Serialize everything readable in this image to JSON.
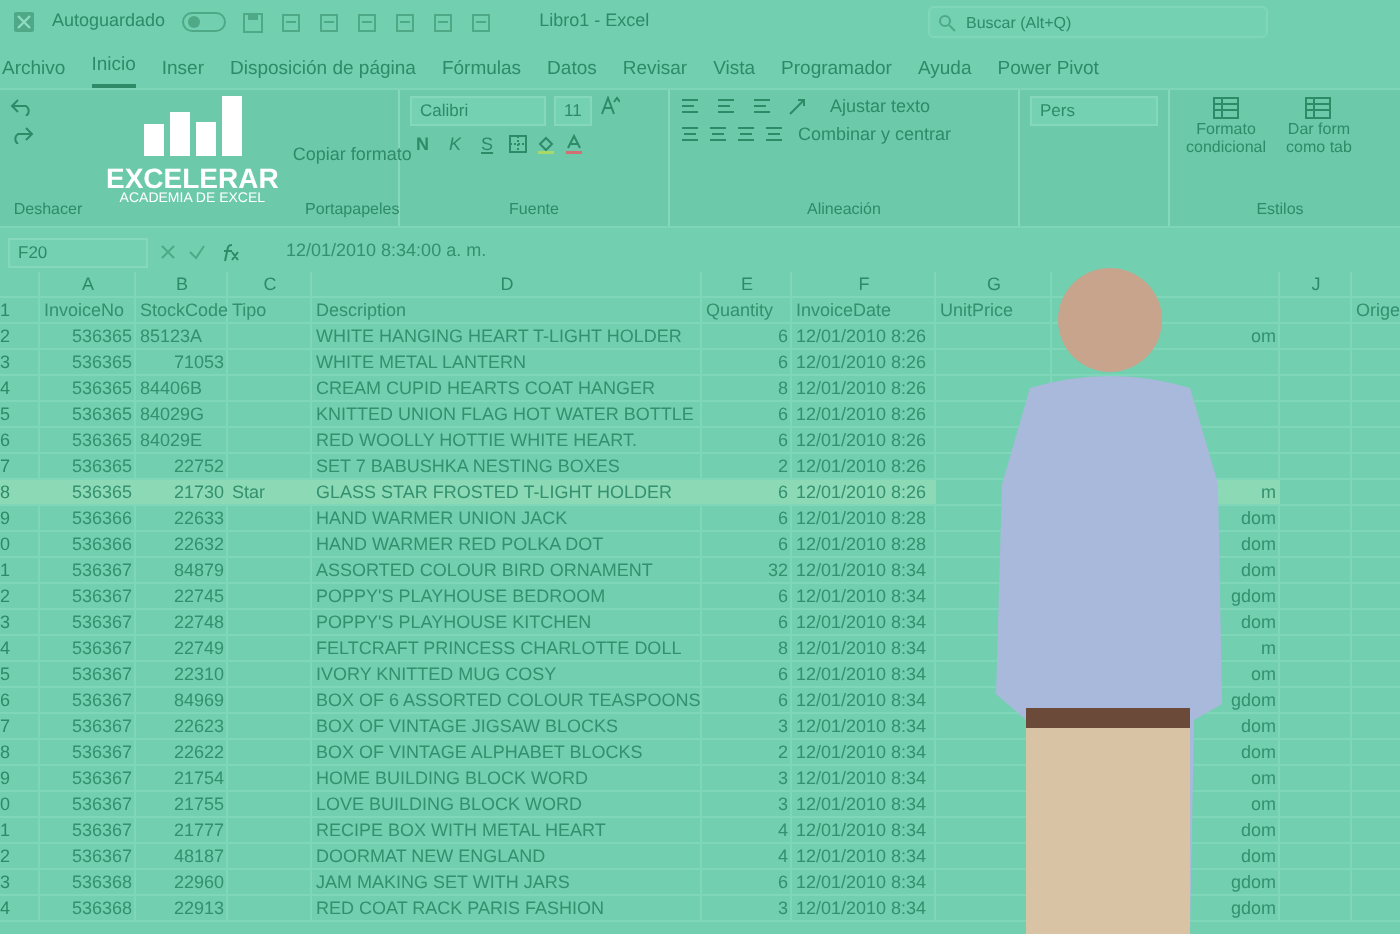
{
  "title_bar": {
    "autosave_label": "Autoguardado",
    "autosave_on": false,
    "document_title": "Libro1 - Excel",
    "search_placeholder": "Buscar (Alt+Q)"
  },
  "logo": {
    "name": "EXCELERAR",
    "tagline": "ACADEMIA DE EXCEL"
  },
  "menu_tabs": [
    {
      "label": "Archivo",
      "selected": false
    },
    {
      "label": "Inicio",
      "selected": true
    },
    {
      "label": "Inser",
      "selected": false
    },
    {
      "label": "Disposición de página",
      "selected": false
    },
    {
      "label": "Fórmulas",
      "selected": false
    },
    {
      "label": "Datos",
      "selected": false
    },
    {
      "label": "Revisar",
      "selected": false
    },
    {
      "label": "Vista",
      "selected": false
    },
    {
      "label": "Programador",
      "selected": false
    },
    {
      "label": "Ayuda",
      "selected": false
    },
    {
      "label": "Power Pivot",
      "selected": false
    }
  ],
  "ribbon": {
    "undo": {
      "label": "Deshacer"
    },
    "clipboard": {
      "label": "Portapapeles",
      "copy_format": "Copiar formato"
    },
    "font": {
      "label": "Fuente",
      "font_name": "Calibri",
      "font_size": "11",
      "bold": "N",
      "italic": "K",
      "underline": "S"
    },
    "alignment": {
      "label": "Alineación",
      "wrap_text": "Ajustar texto",
      "merge_center": "Combinar y centrar"
    },
    "number": {
      "format": "Pers"
    },
    "styles": {
      "label": "Estilos",
      "conditional_format": [
        "Formato",
        "condicional"
      ],
      "format_as_table": [
        "Dar form",
        "como tab"
      ]
    }
  },
  "formula_bar": {
    "cell_ref": "F20",
    "formula": "12/01/2010 8:34:00 a. m."
  },
  "sheet": {
    "columns": [
      {
        "letter": "A",
        "header": "InvoiceNo"
      },
      {
        "letter": "B",
        "header": "StockCode"
      },
      {
        "letter": "C",
        "header": "Tipo"
      },
      {
        "letter": "D",
        "header": "Description"
      },
      {
        "letter": "E",
        "header": "Quantity"
      },
      {
        "letter": "F",
        "header": "InvoiceDate"
      },
      {
        "letter": "G",
        "header": "UnitPrice"
      },
      {
        "letter": "J"
      },
      {
        "header": "Orige"
      }
    ],
    "header_row_number": "1",
    "rows": [
      {
        "num": "2",
        "invoice": "536365",
        "stock": "85123A",
        "description": "WHITE HANGING HEART T-LIGHT HOLDER",
        "quantity": "6",
        "date": "12/01/2010 8:26",
        "fragment": "om",
        "selected": false
      },
      {
        "num": "3",
        "invoice": "536365",
        "stock": "71053",
        "description": "WHITE METAL LANTERN",
        "quantity": "6",
        "date": "12/01/2010 8:26",
        "selected": false
      },
      {
        "num": "4",
        "invoice": "536365",
        "stock": "84406B",
        "description": "CREAM CUPID HEARTS COAT HANGER",
        "quantity": "8",
        "date": "12/01/2010 8:26",
        "selected": false
      },
      {
        "num": "5",
        "invoice": "536365",
        "stock": "84029G",
        "description": "KNITTED UNION FLAG HOT WATER BOTTLE",
        "quantity": "6",
        "date": "12/01/2010 8:26",
        "selected": false
      },
      {
        "num": "6",
        "invoice": "536365",
        "stock": "84029E",
        "description": "RED WOOLLY HOTTIE WHITE HEART.",
        "quantity": "6",
        "date": "12/01/2010 8:26",
        "selected": false
      },
      {
        "num": "7",
        "invoice": "536365",
        "stock": "22752",
        "description": "SET 7 BABUSHKA NESTING BOXES",
        "quantity": "2",
        "date": "12/01/2010 8:26",
        "selected": false
      },
      {
        "num": "8",
        "invoice": "536365",
        "stock": "21730",
        "tipo": "Star",
        "description": "GLASS STAR FROSTED T-LIGHT HOLDER",
        "quantity": "6",
        "date": "12/01/2010 8:26",
        "fragment": "m",
        "selected": true
      },
      {
        "num": "9",
        "invoice": "536366",
        "stock": "22633",
        "description": "HAND WARMER UNION JACK",
        "quantity": "6",
        "date": "12/01/2010 8:28",
        "fragment": "dom",
        "selected": false
      },
      {
        "num": "0",
        "invoice": "536366",
        "stock": "22632",
        "description": "HAND WARMER RED POLKA DOT",
        "quantity": "6",
        "date": "12/01/2010 8:28",
        "fragment": "dom",
        "selected": false
      },
      {
        "num": "1",
        "invoice": "536367",
        "stock": "84879",
        "description": "ASSORTED COLOUR BIRD ORNAMENT",
        "quantity": "32",
        "date": "12/01/2010 8:34",
        "fragment": "dom",
        "selected": false
      },
      {
        "num": "2",
        "invoice": "536367",
        "stock": "22745",
        "description": "POPPY'S PLAYHOUSE BEDROOM",
        "quantity": "6",
        "date": "12/01/2010 8:34",
        "fragment": "gdom",
        "selected": false
      },
      {
        "num": "3",
        "invoice": "536367",
        "stock": "22748",
        "description": "POPPY'S PLAYHOUSE KITCHEN",
        "quantity": "6",
        "date": "12/01/2010 8:34",
        "fragment": "dom",
        "selected": false
      },
      {
        "num": "4",
        "invoice": "536367",
        "stock": "22749",
        "description": "FELTCRAFT PRINCESS CHARLOTTE DOLL",
        "quantity": "8",
        "date": "12/01/2010 8:34",
        "fragment": "m",
        "selected": false
      },
      {
        "num": "5",
        "invoice": "536367",
        "stock": "22310",
        "description": "IVORY KNITTED MUG COSY",
        "quantity": "6",
        "date": "12/01/2010 8:34",
        "fragment": "om",
        "selected": false
      },
      {
        "num": "6",
        "invoice": "536367",
        "stock": "84969",
        "description": "BOX OF 6 ASSORTED COLOUR TEASPOONS",
        "quantity": "6",
        "date": "12/01/2010 8:34",
        "fragment": "gdom",
        "selected": false
      },
      {
        "num": "7",
        "invoice": "536367",
        "stock": "22623",
        "description": "BOX OF VINTAGE JIGSAW BLOCKS",
        "quantity": "3",
        "date": "12/01/2010 8:34",
        "fragment": "dom",
        "selected": false
      },
      {
        "num": "8",
        "invoice": "536367",
        "stock": "22622",
        "description": "BOX OF VINTAGE ALPHABET BLOCKS",
        "quantity": "2",
        "date": "12/01/2010 8:34",
        "fragment": "dom",
        "selected": false
      },
      {
        "num": "9",
        "invoice": "536367",
        "stock": "21754",
        "description": "HOME BUILDING BLOCK WORD",
        "quantity": "3",
        "date": "12/01/2010 8:34",
        "fragment": "om",
        "selected": false
      },
      {
        "num": "0",
        "invoice": "536367",
        "stock": "21755",
        "description": "LOVE BUILDING BLOCK WORD",
        "quantity": "3",
        "date": "12/01/2010 8:34",
        "fragment": "om",
        "selected": false
      },
      {
        "num": "1",
        "invoice": "536367",
        "stock": "21777",
        "description": "RECIPE BOX WITH METAL HEART",
        "quantity": "4",
        "date": "12/01/2010 8:34",
        "fragment": "dom",
        "selected": false
      },
      {
        "num": "2",
        "invoice": "536367",
        "stock": "48187",
        "description": "DOORMAT NEW ENGLAND",
        "quantity": "4",
        "date": "12/01/2010 8:34",
        "fragment": "dom",
        "selected": false
      },
      {
        "num": "3",
        "invoice": "536368",
        "stock": "22960",
        "description": "JAM MAKING SET WITH JARS",
        "quantity": "6",
        "date": "12/01/2010 8:34",
        "fragment": "gdom",
        "selected": false
      },
      {
        "num": "4",
        "invoice": "536368",
        "stock": "22913",
        "description": "RED COAT RACK PARIS FASHION",
        "quantity": "3",
        "date": "12/01/2010 8:34",
        "fragment": "gdom",
        "selected": false
      }
    ]
  }
}
